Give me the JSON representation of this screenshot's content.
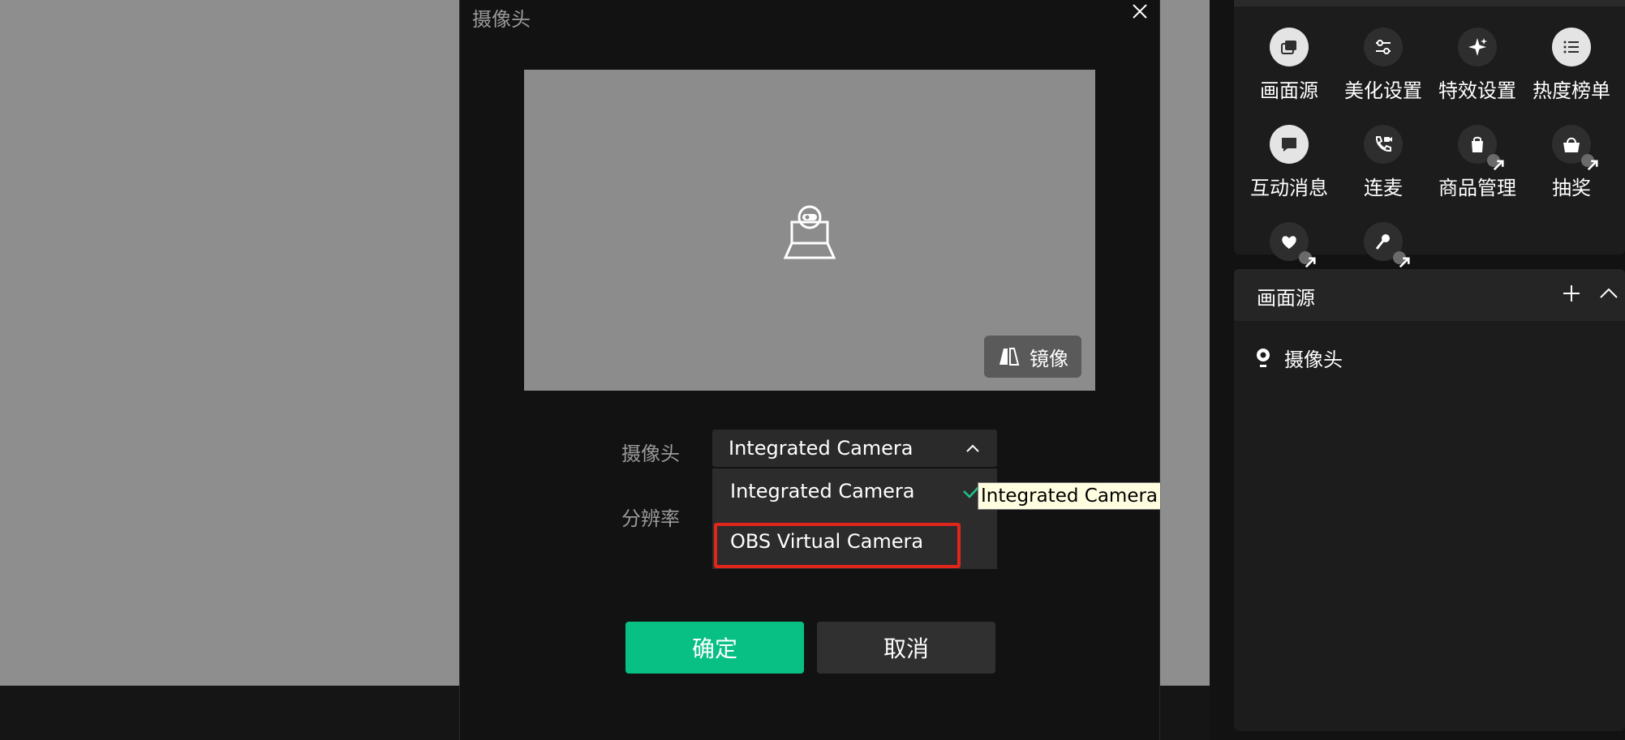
{
  "dialog": {
    "title": "摄像头",
    "mirror_label": "镜像",
    "camera_label": "摄像头",
    "resolution_label": "分辨率",
    "camera_select": {
      "value": "Integrated Camera",
      "options": [
        {
          "label": "Integrated Camera",
          "selected": true
        },
        {
          "label": "OBS Virtual Camera",
          "selected": false
        }
      ]
    },
    "tooltip": "Integrated Camera",
    "ok_label": "确定",
    "cancel_label": "取消"
  },
  "tools": {
    "items": [
      {
        "label": "画面源",
        "icon": "layers-icon"
      },
      {
        "label": "美化设置",
        "icon": "sliders-icon"
      },
      {
        "label": "特效设置",
        "icon": "sparkle-icon"
      },
      {
        "label": "热度榜单",
        "icon": "list-icon"
      },
      {
        "label": "互动消息",
        "icon": "chat-icon"
      },
      {
        "label": "连麦",
        "icon": "phone-video-icon"
      },
      {
        "label": "商品管理",
        "icon": "shopping-bag-icon"
      },
      {
        "label": "抽奖",
        "icon": "lottery-icon"
      },
      {
        "label": "",
        "icon": "heart-sparkle-icon"
      },
      {
        "label": "",
        "icon": "microphone-icon"
      }
    ]
  },
  "source_panel": {
    "title": "画面源",
    "items": [
      {
        "label": "摄像头",
        "icon": "location-pin-icon"
      }
    ]
  },
  "colors": {
    "accent": "#09c084",
    "highlight_border": "#e0261b",
    "background": "#121212"
  }
}
